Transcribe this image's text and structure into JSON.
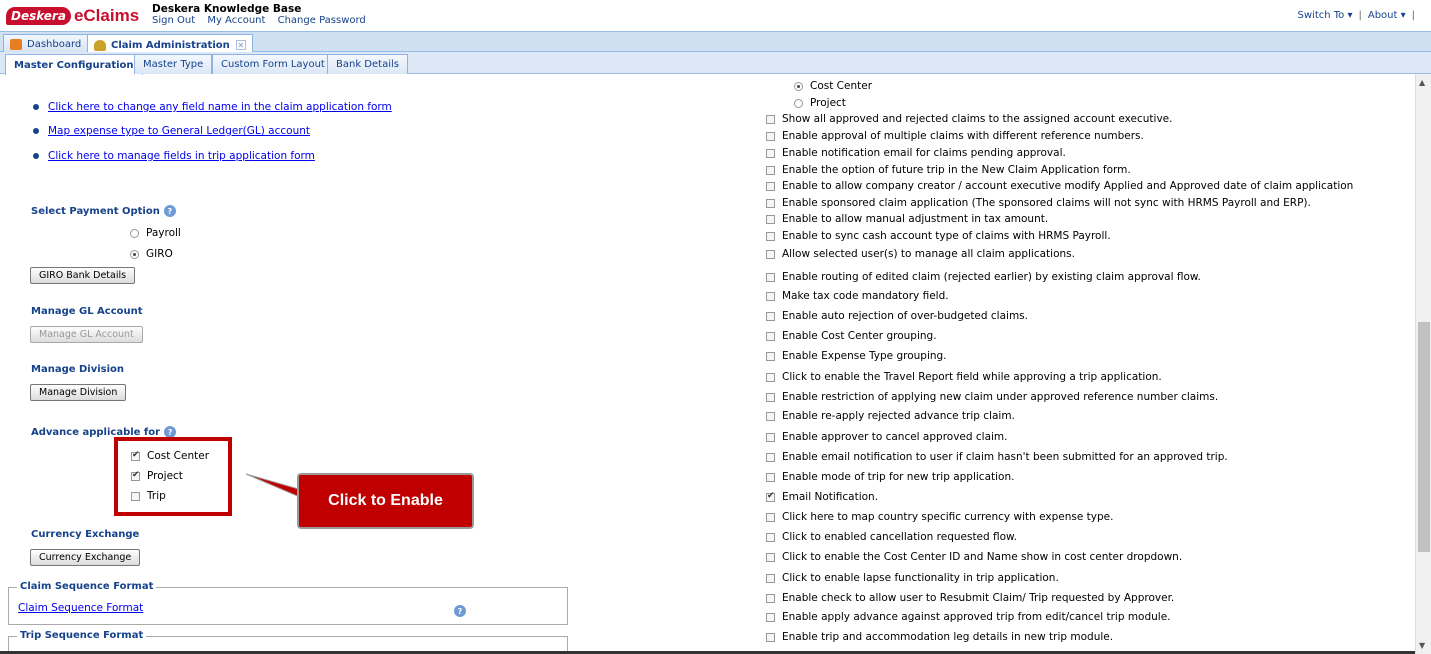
{
  "header": {
    "logo_badge": "Deskera",
    "logo_text": "eClaims",
    "kb_title": "Deskera Knowledge Base",
    "links": [
      "Sign Out",
      "My Account",
      "Change Password"
    ],
    "switch_to": "Switch To ▾",
    "about": "About ▾"
  },
  "main_tabs": [
    {
      "label": "Dashboard",
      "icon": "dashboard-icon"
    },
    {
      "label": "Claim Administration",
      "icon": "user-icon",
      "active": true
    }
  ],
  "sub_tabs": [
    "Master Configuration",
    "Master Type",
    "Custom Form Layout",
    "Bank Details"
  ],
  "left": {
    "links": [
      "Click here to change any field name in the claim application form",
      "Map expense type to General Ledger(GL) account",
      "Click here to manage fields in trip application form"
    ],
    "payment": {
      "label": "Select Payment Option",
      "options": [
        "Payroll",
        "GIRO"
      ],
      "selected": "GIRO",
      "button": "GIRO Bank Details"
    },
    "gl": {
      "label": "Manage GL Account",
      "button": "Manage GL Account"
    },
    "division": {
      "label": "Manage Division",
      "button": "Manage Division"
    },
    "advance": {
      "label": "Advance applicable for",
      "options": [
        {
          "label": "Cost Center",
          "checked": true
        },
        {
          "label": "Project",
          "checked": true
        },
        {
          "label": "Trip",
          "checked": false
        }
      ]
    },
    "callout": "Click to Enable",
    "currency": {
      "label": "Currency Exchange",
      "button": "Currency Exchange"
    },
    "claim_seq": {
      "legend": "Claim Sequence Format",
      "link": "Claim Sequence Format"
    },
    "trip_seq": {
      "legend": "Trip Sequence Format"
    }
  },
  "right": {
    "radios": [
      {
        "label": "Cost Center",
        "selected": true
      },
      {
        "label": "Project",
        "selected": false
      }
    ],
    "options": [
      {
        "label": "Show all approved and rejected claims to the assigned account executive.",
        "checked": false
      },
      {
        "label": "Enable approval of multiple claims with different reference numbers.",
        "checked": false
      },
      {
        "label": "Enable notification email for claims pending approval.",
        "checked": false
      },
      {
        "label": "Enable the option of future trip in the New Claim Application form.",
        "checked": false
      },
      {
        "label": "Enable to allow company creator / account executive modify Applied and Approved date of claim application",
        "checked": false
      },
      {
        "label": "Enable sponsored claim application (The sponsored claims will not sync with HRMS Payroll and ERP).",
        "checked": false
      },
      {
        "label": "Enable to allow manual adjustment in tax amount.",
        "checked": false
      },
      {
        "label": "Enable to sync cash account type of claims with HRMS Payroll.",
        "checked": false
      },
      {
        "label": "Allow selected user(s) to manage all claim applications.",
        "checked": false
      },
      {
        "label": "Enable routing of edited claim (rejected earlier) by existing claim approval flow.",
        "checked": false
      },
      {
        "label": "Make tax code mandatory field.",
        "checked": false
      },
      {
        "label": "Enable auto rejection of over-budgeted claims.",
        "checked": false
      },
      {
        "label": "Enable Cost Center grouping.",
        "checked": false
      },
      {
        "label": "Enable Expense Type grouping.",
        "checked": false
      },
      {
        "label": "Click to enable the Travel Report field while approving a trip application.",
        "checked": false
      },
      {
        "label": "Enable restriction of applying new claim under approved reference number claims.",
        "checked": false
      },
      {
        "label": "Enable re-apply rejected advance trip claim.",
        "checked": false
      },
      {
        "label": "Enable approver to cancel approved claim.",
        "checked": false
      },
      {
        "label": "Enable email notification to user if claim hasn't been submitted for an approved trip.",
        "checked": false
      },
      {
        "label": "Enable mode of trip for new trip application.",
        "checked": false
      },
      {
        "label": "Email Notification.",
        "checked": true
      },
      {
        "label": "Click here to map country specific currency with expense type.",
        "checked": false
      },
      {
        "label": "Click to enabled cancellation requested flow.",
        "checked": false
      },
      {
        "label": "Click to enable the Cost Center ID and Name show in cost center dropdown.",
        "checked": false
      },
      {
        "label": "Click to enable lapse functionality in trip application.",
        "checked": false
      },
      {
        "label": "Enable check to allow user to Resubmit Claim/ Trip requested by Approver.",
        "checked": false
      },
      {
        "label": "Enable apply advance against approved trip from edit/cancel trip module.",
        "checked": false
      },
      {
        "label": "Enable trip and accommodation leg details in new trip module.",
        "checked": false
      }
    ]
  },
  "colors": {
    "brand": "#c8102e",
    "link": "#0000ee",
    "label": "#15428b",
    "callout": "#c00000"
  }
}
